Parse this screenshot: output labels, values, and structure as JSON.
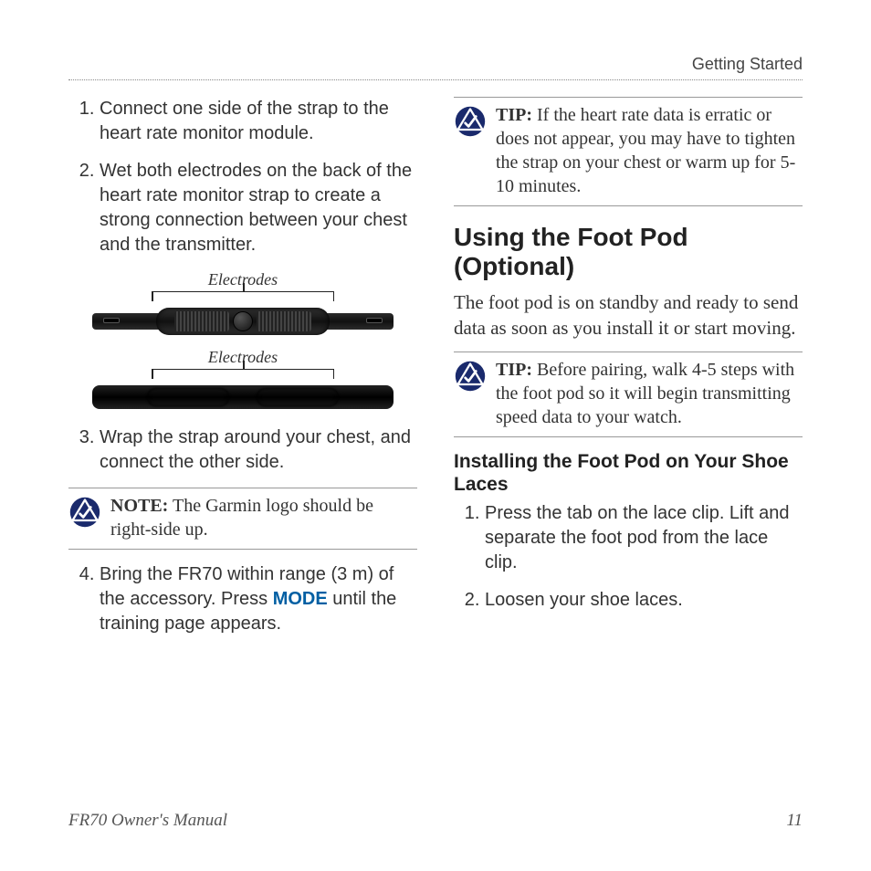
{
  "header": {
    "breadcrumb": "Getting Started"
  },
  "left": {
    "steps12": [
      "Connect one side of the strap to the heart rate monitor module.",
      "Wet both electrodes on the back of the heart rate monitor strap to create a strong connection between your chest and the transmitter."
    ],
    "diagram": {
      "label_top": "Electrodes",
      "label_bottom": "Electrodes"
    },
    "step3": "Wrap the strap around your chest, and connect the other side.",
    "note": {
      "label": "NOTE:",
      "text": " The Garmin logo should be right-side up."
    },
    "step4_pre": "Bring the FR70 within range (3 m) of the accessory. Press ",
    "step4_mode": "MODE",
    "step4_post": " until the training page appears."
  },
  "right": {
    "tip1": {
      "label": "TIP:",
      "text": " If the heart rate data is erratic or does not appear, you may have to tighten the strap on your chest or warm up for 5-10 minutes."
    },
    "section_title": "Using the Foot Pod (Optional)",
    "section_body": "The foot pod is on standby and ready to send data as soon as you install it or start moving.",
    "tip2": {
      "label": "TIP:",
      "text": " Before pairing, walk 4-5 steps with the foot pod so it will begin transmitting speed data to your watch."
    },
    "subsection_title": "Installing the Foot Pod on Your Shoe Laces",
    "sub_steps": [
      "Press the tab on the lace clip. Lift and separate the foot pod from the lace clip.",
      "Loosen your shoe laces."
    ]
  },
  "footer": {
    "left": "FR70 Owner's Manual",
    "right": "11"
  }
}
